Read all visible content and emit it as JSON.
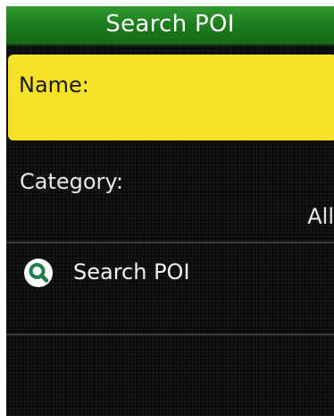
{
  "header": {
    "title": "Search POI"
  },
  "form": {
    "name_label": "Name:",
    "name_value": "",
    "category_label": "Category:",
    "category_value": "All"
  },
  "actions": {
    "search_label": "Search POI",
    "search_icon": "magnifier-icon"
  },
  "colors": {
    "title_bar": "#1d7a1d",
    "highlight": "#f6e227",
    "background": "#0b0b0b"
  }
}
